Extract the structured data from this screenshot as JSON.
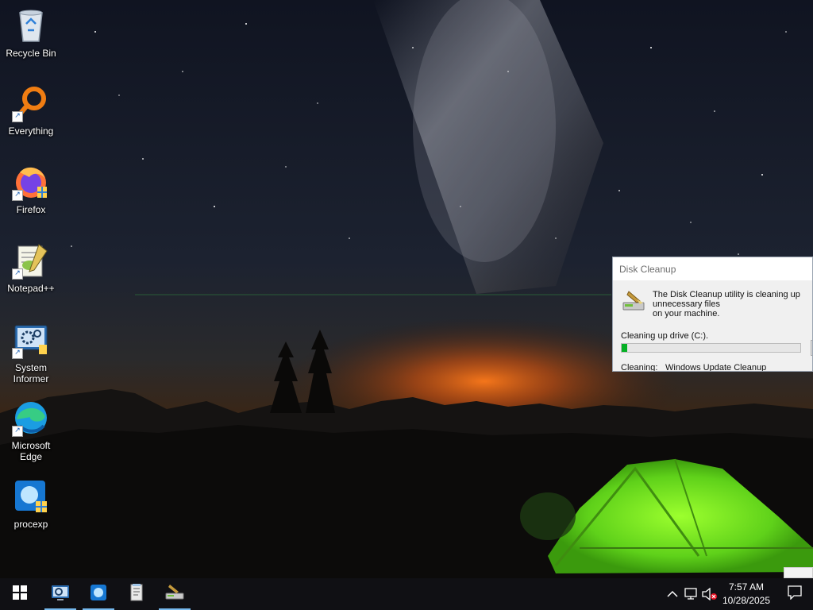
{
  "desktop": {
    "icons": [
      {
        "name": "recycle-bin",
        "label": "Recycle Bin",
        "icon": "recycle-bin-icon",
        "shortcut": false
      },
      {
        "name": "everything",
        "label": "Everything",
        "icon": "magnifier-icon",
        "shortcut": true
      },
      {
        "name": "firefox",
        "label": "Firefox",
        "icon": "firefox-icon",
        "shortcut": true
      },
      {
        "name": "notepad-plus-plus",
        "label": "Notepad++",
        "icon": "notepad-plus-plus-icon",
        "shortcut": true
      },
      {
        "name": "system-informer",
        "label": "System\nInformer",
        "icon": "system-informer-icon",
        "shortcut": true
      },
      {
        "name": "microsoft-edge",
        "label": "Microsoft\nEdge",
        "icon": "edge-icon",
        "shortcut": true
      },
      {
        "name": "procexp",
        "label": "procexp",
        "icon": "procexp-icon",
        "shortcut": true
      }
    ]
  },
  "dialog": {
    "title": "Disk Cleanup",
    "message": "The Disk Cleanup utility is cleaning up unnecessary files\non your machine.",
    "drive_label": "Cleaning up drive  (C:).",
    "progress": 0.03,
    "cleaning_label": "Cleaning:",
    "cleaning_value": "Windows Update Cleanup",
    "icon": "disk-cleanup-icon"
  },
  "taskbar": {
    "start_icon": "windows-logo-icon",
    "pinned": [
      {
        "name": "system-informer",
        "icon": "system-informer-icon",
        "active": true
      },
      {
        "name": "procexp",
        "icon": "procexp-icon",
        "active": true
      },
      {
        "name": "notepad",
        "icon": "notepad-icon",
        "active": false
      },
      {
        "name": "disk-cleanup",
        "icon": "disk-cleanup-icon",
        "active": true
      }
    ],
    "tray": {
      "icons": [
        "chevron-up-icon",
        "network-icon",
        "volume-muted-icon"
      ],
      "time": "7:57 AM",
      "date": "10/28/2025",
      "notification_icon": "notification-icon"
    }
  },
  "colors": {
    "taskbar_bg": "#101014",
    "accent_underline": "#76b9ed",
    "progress_green": "#06b025"
  }
}
